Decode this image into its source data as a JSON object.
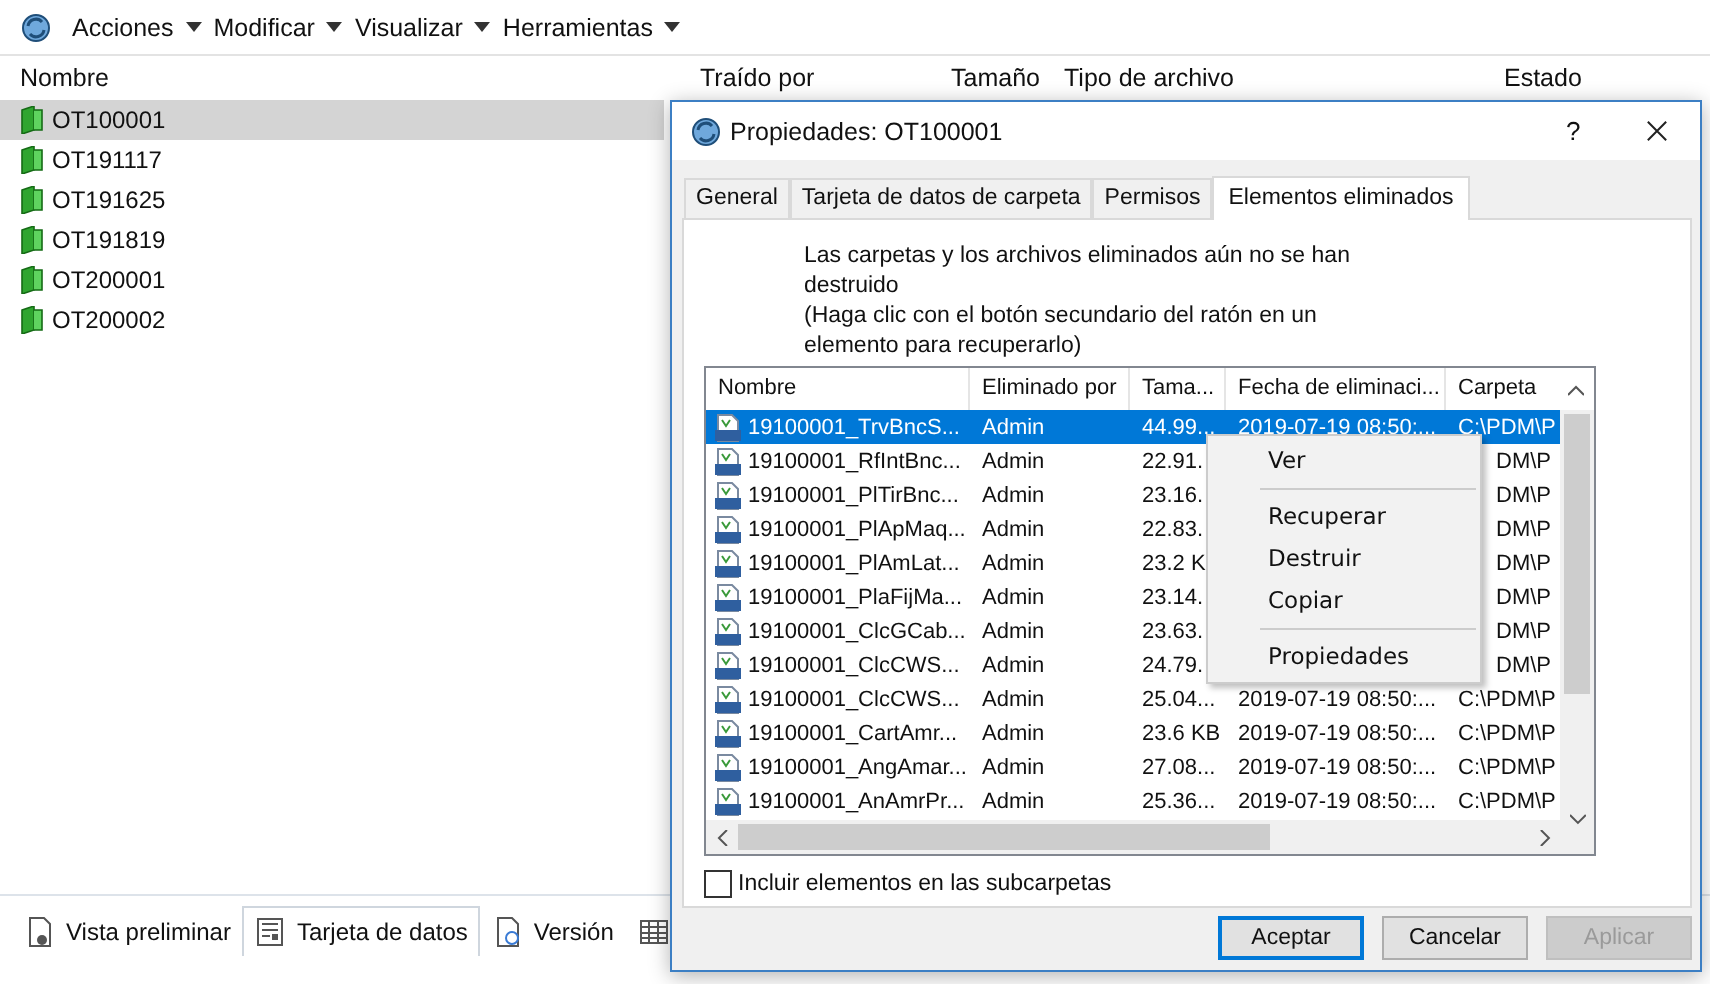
{
  "toolbar": {
    "menus": [
      {
        "label": "Acciones"
      },
      {
        "label": "Modificar"
      },
      {
        "label": "Visualizar"
      },
      {
        "label": "Herramientas"
      }
    ]
  },
  "file_list": {
    "columns": [
      "Nombre",
      "Traído por",
      "Tamaño",
      "Tipo de archivo",
      "Estado"
    ],
    "rows": [
      {
        "name": "OT100001",
        "selected": true
      },
      {
        "name": "OT191117",
        "selected": false
      },
      {
        "name": "OT191625",
        "selected": false
      },
      {
        "name": "OT191819",
        "selected": false
      },
      {
        "name": "OT200001",
        "selected": false
      },
      {
        "name": "OT200002",
        "selected": false
      }
    ]
  },
  "bottom_tabs": [
    {
      "kind": "preview",
      "label": "Vista preliminar",
      "selected": false
    },
    {
      "kind": "datacard",
      "label": "Tarjeta de datos",
      "selected": true
    },
    {
      "kind": "version",
      "label": "Versión",
      "selected": false
    },
    {
      "kind": "table",
      "selected": false
    }
  ],
  "dialog": {
    "title": "Propiedades: OT100001",
    "help": "?",
    "tabs": [
      {
        "label": "General",
        "selected": false
      },
      {
        "label": "Tarjeta de datos de carpeta",
        "selected": false
      },
      {
        "label": "Permisos",
        "selected": false
      },
      {
        "label": "Elementos eliminados",
        "selected": true
      }
    ],
    "message_lines": [
      "Las carpetas y los archivos eliminados aún no se han",
      "destruido",
      "(Haga clic con el botón secundario del ratón en un",
      "elemento para recuperarlo)"
    ],
    "deleted_items": {
      "columns": [
        "Nombre",
        "Eliminado por",
        "Tama...",
        "Fecha de eliminaci...",
        "Carpeta"
      ],
      "rows": [
        {
          "name": "19100001_TrvBncS...",
          "by": "Admin",
          "size": "44.99...",
          "date": "2019-07-19 08:50:...",
          "folder": "C:\\PDM\\P",
          "selected": true
        },
        {
          "name": "19100001_RfIntBnc...",
          "by": "Admin",
          "size": "22.91.",
          "folder": "DM\\P",
          "selected": false
        },
        {
          "name": "19100001_PlTirBnc...",
          "by": "Admin",
          "size": "23.16.",
          "folder": "DM\\P",
          "selected": false
        },
        {
          "name": "19100001_PlApMaq...",
          "by": "Admin",
          "size": "22.83.",
          "folder": "DM\\P",
          "selected": false
        },
        {
          "name": "19100001_PlAmLat...",
          "by": "Admin",
          "size": "23.2 K",
          "folder": "DM\\P",
          "selected": false
        },
        {
          "name": "19100001_PlaFijMa...",
          "by": "Admin",
          "size": "23.14.",
          "folder": "DM\\P",
          "selected": false
        },
        {
          "name": "19100001_ClcGCab...",
          "by": "Admin",
          "size": "23.63.",
          "folder": "DM\\P",
          "selected": false
        },
        {
          "name": "19100001_ClcCWS...",
          "by": "Admin",
          "size": "24.79.",
          "folder": "DM\\P",
          "selected": false
        },
        {
          "name": "19100001_ClcCWS...",
          "by": "Admin",
          "size": "25.04...",
          "date": "2019-07-19 08:50:...",
          "folder": "C:\\PDM\\P",
          "selected": false
        },
        {
          "name": "19100001_CartAmr...",
          "by": "Admin",
          "size": "23.6 KB",
          "date": "2019-07-19 08:50:...",
          "folder": "C:\\PDM\\P",
          "selected": false
        },
        {
          "name": "19100001_AngAmar...",
          "by": "Admin",
          "size": "27.08...",
          "date": "2019-07-19 08:50:...",
          "folder": "C:\\PDM\\P",
          "selected": false
        },
        {
          "name": "19100001_AnAmrPr...",
          "by": "Admin",
          "size": "25.36...",
          "date": "2019-07-19 08:50:...",
          "folder": "C:\\PDM\\P",
          "selected": false
        }
      ]
    },
    "context_menu": {
      "items": [
        {
          "kind": "item",
          "label": "Ver"
        },
        {
          "kind": "separator"
        },
        {
          "kind": "item",
          "label": "Recuperar"
        },
        {
          "kind": "item",
          "label": "Destruir"
        },
        {
          "kind": "item",
          "label": "Copiar"
        },
        {
          "kind": "separator"
        },
        {
          "kind": "item",
          "label": "Propiedades"
        }
      ]
    },
    "include_subfolders": {
      "label": "Incluir elementos en las subcarpetas",
      "checked": false
    },
    "buttons": [
      {
        "label": "Aceptar",
        "default": true,
        "disabled": false
      },
      {
        "label": "Cancelar",
        "default": false,
        "disabled": false
      },
      {
        "label": "Aplicar",
        "default": false,
        "disabled": true
      }
    ]
  }
}
